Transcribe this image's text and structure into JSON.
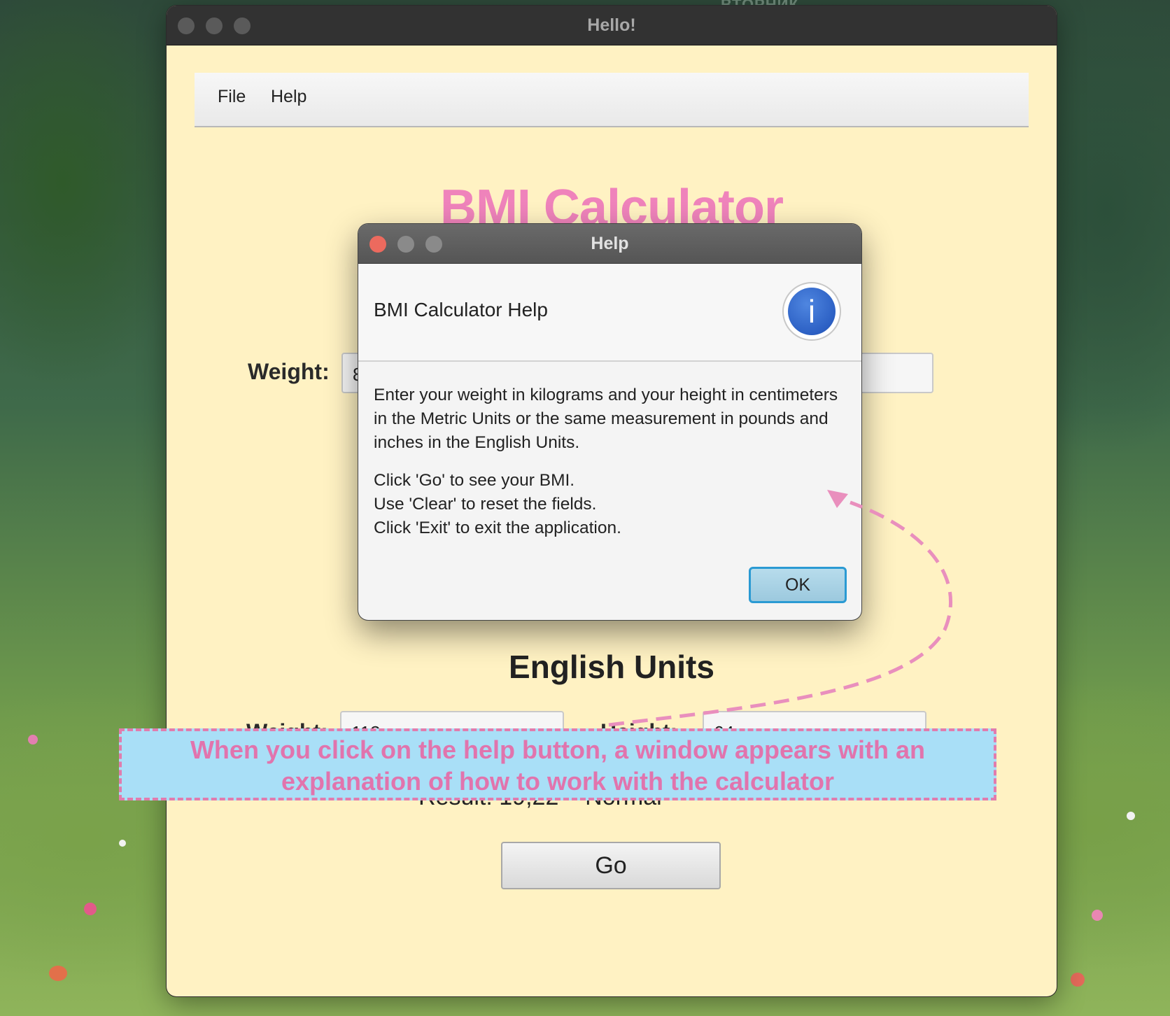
{
  "wallpaper": {
    "label": "ВТОРНИК"
  },
  "window": {
    "title": "Hello!"
  },
  "menu": {
    "items": [
      "File",
      "Help"
    ]
  },
  "app": {
    "title": "BMI Calculator",
    "metric": {
      "weight_label": "Weight:",
      "weight_value": "8"
    },
    "english": {
      "section_title": "English Units",
      "weight_label": "Weight:",
      "weight_value": "112",
      "height_label": "Height:",
      "height_value": "64"
    },
    "result": "Result: 19,22 – Normal",
    "go_label": "Go"
  },
  "dialog": {
    "title": "Help",
    "header": "BMI Calculator Help",
    "icon": "info-icon",
    "body": [
      "Enter your weight in kilograms and your height in centimeters",
      "in the Metric Units or the same measurement in pounds and",
      "inches in the English Units.",
      "",
      "Click 'Go' to see your BMI.",
      "Use 'Clear' to reset the fields.",
      "Click 'Exit' to exit the application."
    ],
    "ok_label": "OK"
  },
  "annotation": {
    "line1": "When you click on the help button, a window appears with an",
    "line2": "explanation of how to work with the calculator"
  },
  "colors": {
    "window_bg": "#fff2c3",
    "title_pink": "#ef83bb",
    "annotation_bg": "#a9dff7",
    "annotation_text": "#e174ad",
    "ok_border": "#2a9ad3",
    "close_red": "#ec6a5e"
  }
}
